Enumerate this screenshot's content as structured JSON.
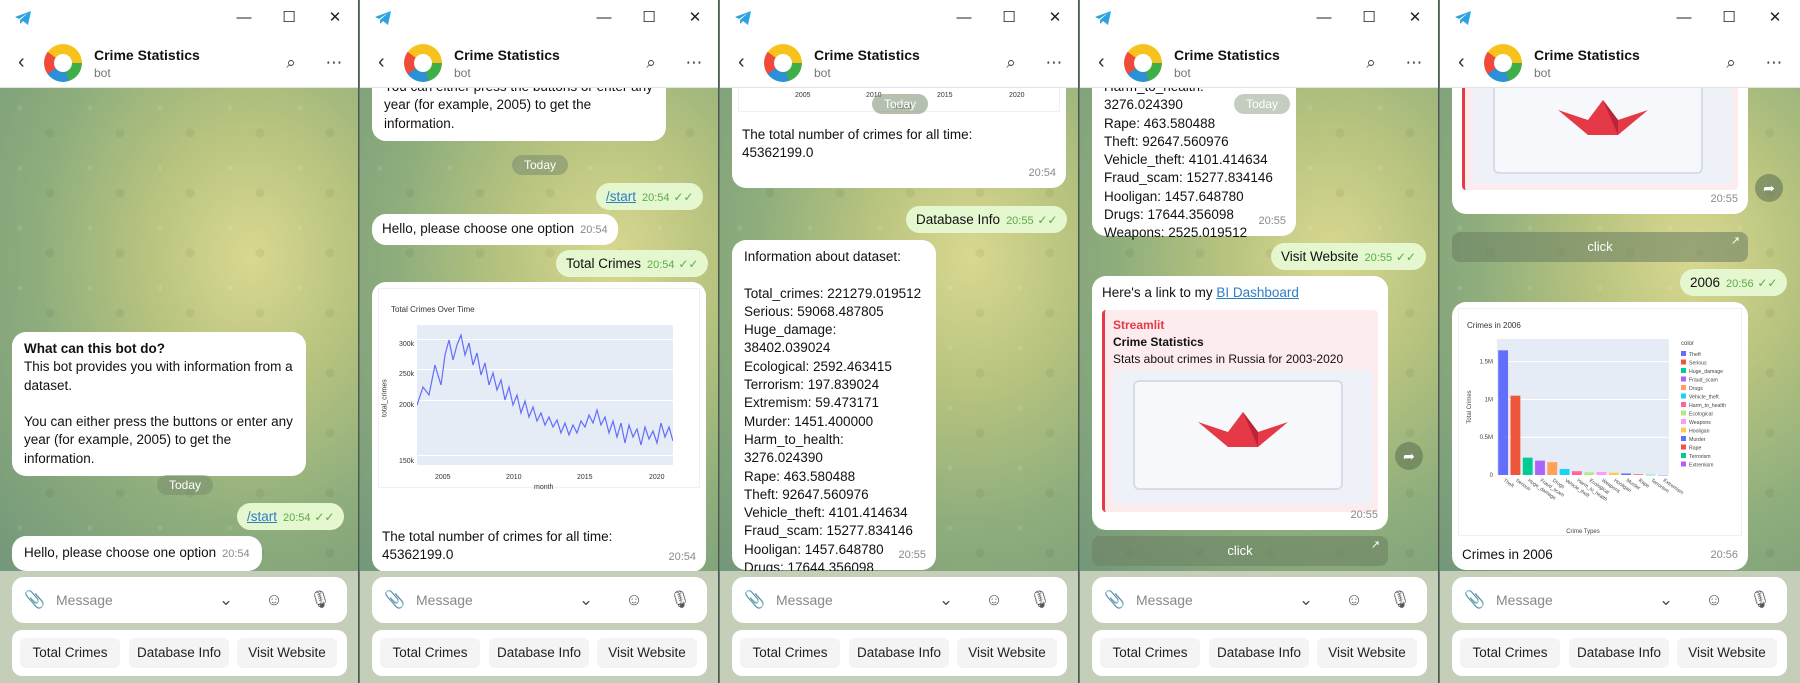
{
  "app": {
    "chat_title": "Crime Statistics",
    "chat_subtitle": "bot",
    "composer_placeholder": "Message",
    "keyboard_buttons": [
      "Total Crimes",
      "Database Info",
      "Visit Website"
    ]
  },
  "w1": {
    "intro_title": "What can this bot do?",
    "intro_body": "This bot provides you with information from a dataset.\n\nYou can either press the buttons or enter any year (for example, 2005) to get the information.",
    "date_pill": "Today",
    "start_cmd": "/start",
    "start_time": "20:54",
    "hello": "Hello, please choose one option",
    "hello_time": "20:54"
  },
  "w2": {
    "intro_tail": "You can either press the buttons or enter any year (for example, 2005) to get the information.",
    "date_pill": "Today",
    "start_cmd": "/start",
    "start_time": "20:54",
    "hello": "Hello, please choose one option",
    "hello_time": "20:54",
    "total_cmd": "Total Crimes",
    "total_time": "20:54",
    "caption": "The total number of crimes for all time:\n45362199.0",
    "caption_time": "20:54"
  },
  "w3": {
    "date_pill": "Today",
    "caption": "The total number of crimes for all time:\n45362199.0",
    "caption_time": "20:54",
    "db_cmd": "Database Info",
    "db_time": "20:55",
    "info": "Information about dataset:\n\nTotal_crimes: 221279.019512\nSerious: 59068.487805\nHuge_damage: 38402.039024\nEcological: 2592.463415\nTerrorism: 197.839024\nExtremism: 59.473171\nMurder: 1451.400000\nHarm_to_health: 3276.024390\nRape: 463.580488\nTheft: 92647.560976\nVehicle_theft: 4101.414634\nFraud_scam: 15277.834146\nHooligan: 1457.648780\nDrugs: 17644.356098\nWeapons: 2525.019512",
    "info_time": "20:55"
  },
  "w4": {
    "date_pill": "Today",
    "info_tail": "Harm_to_health: 3276.024390\nRape: 463.580488\nTheft: 92647.560976\nVehicle_theft: 4101.414634\nFraud_scam: 15277.834146\nHooligan: 1457.648780\nDrugs: 17644.356098\nWeapons: 2525.019512",
    "info_time": "20:55",
    "visit_cmd": "Visit Website",
    "visit_time": "20:55",
    "link_prefix": "Here's a link to my ",
    "link_text": "BI Dashboard",
    "site_name": "Streamlit",
    "site_title": "Crime Statistics",
    "site_desc": "Stats about crimes in Russia for 2003-2020",
    "link_time": "20:55",
    "button": "click"
  },
  "w5": {
    "preview_time": "20:55",
    "button": "click",
    "year_cmd": "2006",
    "year_time": "20:56",
    "caption": "Crimes in 2006",
    "caption_time": "20:56"
  },
  "line_chart": {
    "title": "Total Crimes Over Time",
    "ylabel": "total_crimes",
    "xlabel": "month",
    "yticks": [
      "300k",
      "250k",
      "200k",
      "150k"
    ],
    "xticks": [
      "2005",
      "2010",
      "2015",
      "2020"
    ]
  },
  "chart_data": {
    "type": "bar",
    "title": "Crimes in 2006",
    "xlabel": "Crime Types",
    "ylabel": "Total Crimes",
    "legend_title": "color",
    "categories": [
      "Theft",
      "Serious",
      "Huge_damage",
      "Fraud_scam",
      "Drugs",
      "Vehicle_theft",
      "Harm_to_health",
      "Ecological",
      "Weapons",
      "Hooligan",
      "Murder",
      "Rape",
      "Terrorism",
      "Extremism"
    ],
    "values": [
      1650000,
      1050000,
      230000,
      190000,
      170000,
      80000,
      50000,
      35000,
      40000,
      30000,
      20000,
      8000,
      3000,
      1000
    ],
    "colors": [
      "#636efa",
      "#ef553b",
      "#00cc96",
      "#ab63fa",
      "#ffa15a",
      "#19d3f3",
      "#ff6692",
      "#b6e880",
      "#ff97ff",
      "#fecb52",
      "#636efa",
      "#ef553b",
      "#00cc96",
      "#ab63fa"
    ],
    "yticks": [
      "1.5M",
      "1M",
      "0.5M",
      "0"
    ],
    "ylim": [
      0,
      1800000
    ]
  }
}
